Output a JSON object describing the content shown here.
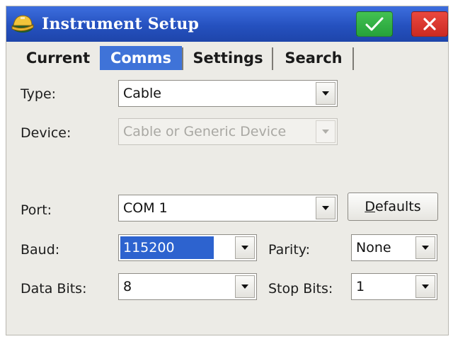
{
  "window": {
    "title": "Instrument Setup"
  },
  "titlebar": {
    "ok_icon": "check-icon",
    "close_icon": "close-icon",
    "ok_color": "#2fae43",
    "close_color": "#d9362d"
  },
  "tabs": [
    {
      "label": "Current",
      "active": false
    },
    {
      "label": "Comms",
      "active": true
    },
    {
      "label": "Settings",
      "active": false
    },
    {
      "label": "Search",
      "active": false
    }
  ],
  "form": {
    "type": {
      "label": "Type:",
      "value": "Cable"
    },
    "device": {
      "label": "Device:",
      "value": "Cable or Generic Device",
      "disabled": true
    },
    "port": {
      "label": "Port:",
      "value": "COM 1"
    },
    "defaults_button": {
      "accel": "D",
      "rest": "efaults"
    },
    "baud": {
      "label": "Baud:",
      "value": "115200"
    },
    "parity": {
      "label": "Parity:",
      "value": "None"
    },
    "data_bits": {
      "label": "Data Bits:",
      "value": "8"
    },
    "stop_bits": {
      "label": "Stop Bits:",
      "value": "1"
    }
  }
}
